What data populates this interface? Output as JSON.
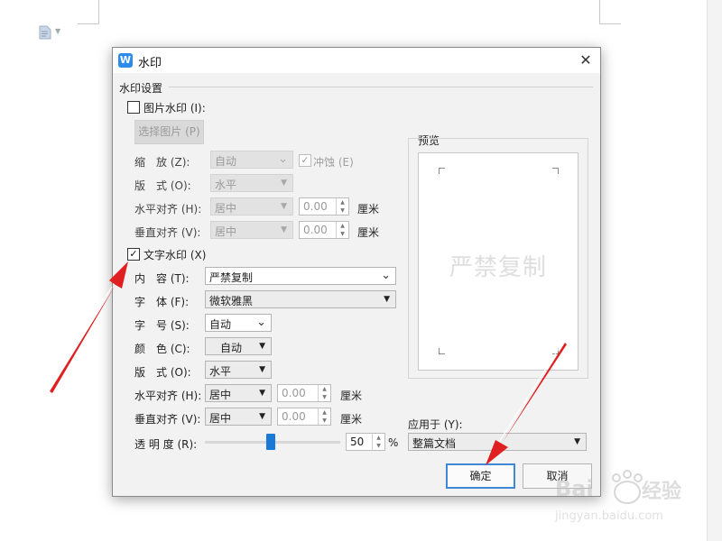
{
  "document": {
    "icon": "document-icon",
    "dropdown_icon": "chevron-down-icon"
  },
  "dialog": {
    "title": "水印",
    "close_icon": "close-icon",
    "section_label": "水印设置",
    "picture_watermark": {
      "checkbox_label": "图片水印 (I):",
      "checked": false,
      "select_image_button": "选择图片 (P)",
      "scale_label": "缩　放 (Z):",
      "scale_value": "自动",
      "washout_label": "冲蚀 (E)",
      "washout_checked": true,
      "layout_label": "版　式 (O):",
      "layout_value": "水平",
      "h_align_label": "水平对齐 (H):",
      "h_align_value": "居中",
      "h_offset": "0.00",
      "h_unit": "厘米",
      "v_align_label": "垂直对齐 (V):",
      "v_align_value": "居中",
      "v_offset": "0.00",
      "v_unit": "厘米"
    },
    "text_watermark": {
      "checkbox_label": "文字水印 (X)",
      "checked": true,
      "content_label": "内　容 (T):",
      "content_value": "严禁复制",
      "font_label": "字　体 (F):",
      "font_value": "微软雅黑",
      "size_label": "字　号 (S):",
      "size_value": "自动",
      "color_label": "颜　色 (C):",
      "color_value": "自动",
      "layout_label": "版　式 (O):",
      "layout_value": "水平",
      "h_align_label": "水平对齐 (H):",
      "h_align_value": "居中",
      "h_offset": "0.00",
      "h_unit": "厘米",
      "v_align_label": "垂直对齐 (V):",
      "v_align_value": "居中",
      "v_offset": "0.00",
      "v_unit": "厘米",
      "transparency_label": "透 明 度 (R):",
      "transparency_value": "50",
      "transparency_unit": "%",
      "transparency_slider_fraction": 0.5
    },
    "preview": {
      "label": "预览",
      "watermark_text": "严禁复制"
    },
    "apply_to_label": "应用于 (Y):",
    "apply_to_value": "整篇文档",
    "ok_button": "确定",
    "cancel_button": "取消"
  },
  "colors": {
    "accent": "#1a79d6",
    "annotation_arrow": "#e02020",
    "dialog_bg": "#f2f2f2"
  },
  "icons": {
    "title_logo": "wps-logo-icon",
    "arrows": "annotation-arrow-icon"
  }
}
